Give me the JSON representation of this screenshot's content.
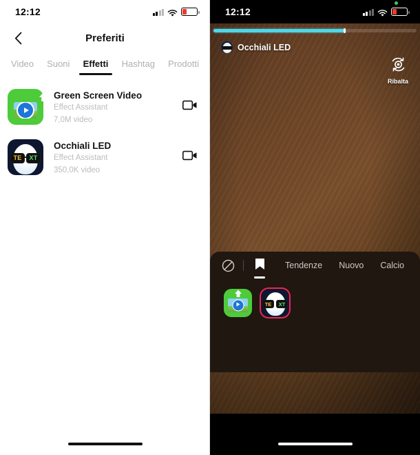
{
  "left_screen": {
    "statusbar": {
      "time": "12:12",
      "signal_icon": "cellular-bars-icon",
      "wifi_icon": "wifi-icon",
      "battery_icon": "battery-low-icon"
    },
    "navbar": {
      "back_icon": "chevron-left-icon",
      "title": "Preferiti"
    },
    "tabs": [
      {
        "label": "Video",
        "active": false
      },
      {
        "label": "Suoni",
        "active": false
      },
      {
        "label": "Effetti",
        "active": true
      },
      {
        "label": "Hashtag",
        "active": false
      },
      {
        "label": "Prodotti",
        "active": false
      }
    ],
    "items": [
      {
        "title": "Green Screen Video",
        "author": "Effect Assistant",
        "stats": "7,0M video",
        "thumb_icon": "green-screen-effect-thumbnail",
        "action_icon": "video-camera-icon"
      },
      {
        "title": "Occhiali LED",
        "author": "Effect Assistant",
        "stats": "350,0K video",
        "thumb_icon": "led-glasses-effect-thumbnail",
        "action_icon": "video-camera-icon",
        "lens_left": "TE",
        "lens_right": "XT"
      }
    ]
  },
  "right_screen": {
    "statusbar": {
      "time": "12:12",
      "camera_indicator": "green-privacy-dot",
      "signal_icon": "cellular-bars-icon",
      "wifi_icon": "wifi-icon",
      "battery_icon": "battery-low-icon"
    },
    "recording": {
      "progress_percent": 65,
      "progress_color": "#4fd6e8"
    },
    "effect_chip": {
      "label": "Occhiali LED",
      "icon": "led-glasses-effect-thumbnail"
    },
    "flip_button": {
      "label": "Ribalta",
      "icon": "camera-flip-icon"
    },
    "favorite_button": {
      "icon": "bookmark-filled-icon",
      "color": "#f2234f"
    },
    "effect_tray": {
      "no_effect_icon": "no-effect-icon",
      "bookmark_tab_icon": "bookmark-icon",
      "categories": [
        {
          "label": "Tendenze",
          "active": false
        },
        {
          "label": "Nuovo",
          "active": false
        },
        {
          "label": "Calcio",
          "active": false
        }
      ],
      "effects": [
        {
          "name": "green-screen-effect",
          "selected": false
        },
        {
          "name": "led-glasses-effect",
          "selected": true,
          "lens_left": "TE",
          "lens_right": "XT"
        }
      ]
    }
  }
}
